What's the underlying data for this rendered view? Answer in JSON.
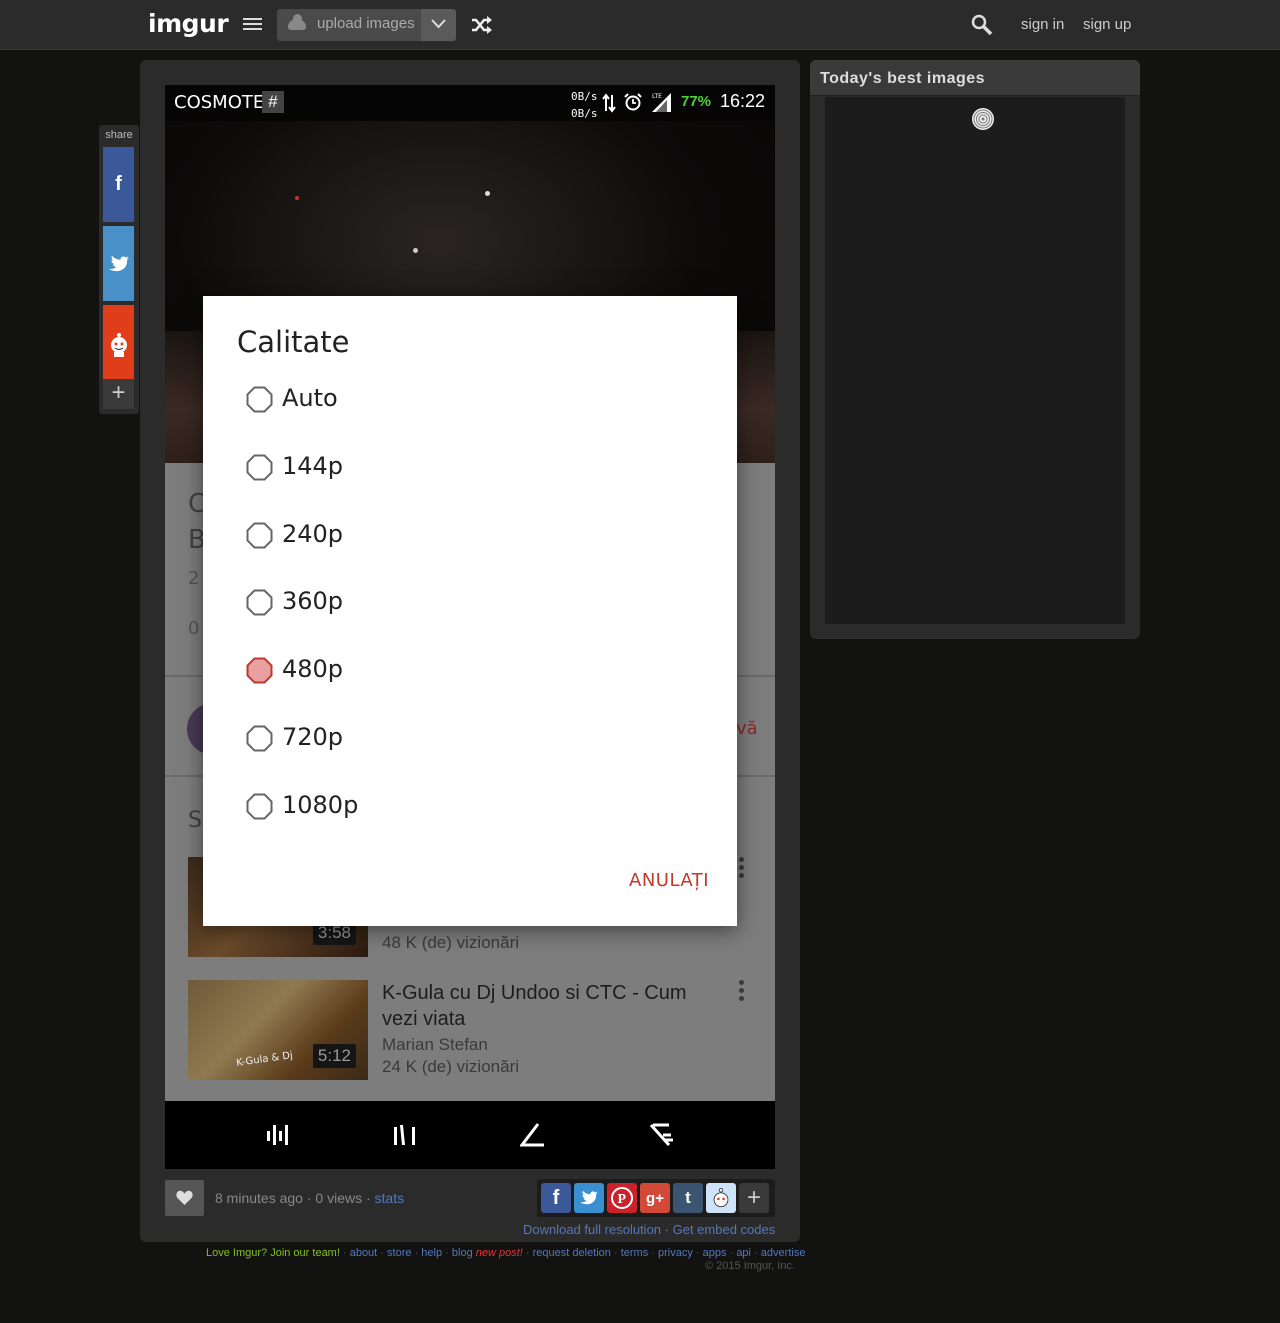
{
  "header": {
    "logo": "imgur",
    "upload_label": "upload images",
    "sign_in": "sign in",
    "sign_up": "sign up"
  },
  "share_sidebar": {
    "label": "share"
  },
  "phone": {
    "status": {
      "carrier": "COSMOTE",
      "hash": "#",
      "net_up": "0B/s",
      "net_down": "0B/s",
      "battery": "77%",
      "time": "16:22"
    },
    "background": {
      "title_line1_partial": "C",
      "title_line2_partial": "B",
      "views_partial": "2",
      "likes_partial": "0",
      "subscribe_partial": "vă",
      "section_partial": "S"
    },
    "related": [
      {
        "duration": "3:58",
        "views": "48 K (de) vizionări"
      },
      {
        "title": "K-Gula cu Dj Undoo si CTC - Cum vezi viata",
        "author": "Marian Stefan",
        "views": "24 K (de) vizionări",
        "duration": "5:12",
        "thumb_text": "K-Gula & Dj"
      }
    ],
    "dialog": {
      "title": "Calitate",
      "options": [
        {
          "label": "Auto",
          "selected": false
        },
        {
          "label": "144p",
          "selected": false
        },
        {
          "label": "240p",
          "selected": false
        },
        {
          "label": "360p",
          "selected": false
        },
        {
          "label": "480p",
          "selected": true
        },
        {
          "label": "720p",
          "selected": false
        },
        {
          "label": "1080p",
          "selected": false
        }
      ],
      "cancel": "ANULAȚI"
    }
  },
  "post_meta": {
    "time": "8 minutes ago",
    "views": "0 views",
    "stats": "stats",
    "download": "Download full resolution",
    "embed": "Get embed codes"
  },
  "right_panel": {
    "title": "Today's best images"
  },
  "footer": {
    "join": "Love Imgur? Join our team!",
    "links": [
      "about",
      "store",
      "help",
      "blog"
    ],
    "new_post": "new post!",
    "links2": [
      "request deletion",
      "terms",
      "privacy",
      "apps",
      "api",
      "advertise"
    ],
    "copyright": "© 2015 Imgur, Inc."
  },
  "colors": {
    "accent_red": "#c0392b",
    "battery_green": "#4cd137",
    "link_blue": "#5577bb",
    "join_green": "#85bf25"
  }
}
